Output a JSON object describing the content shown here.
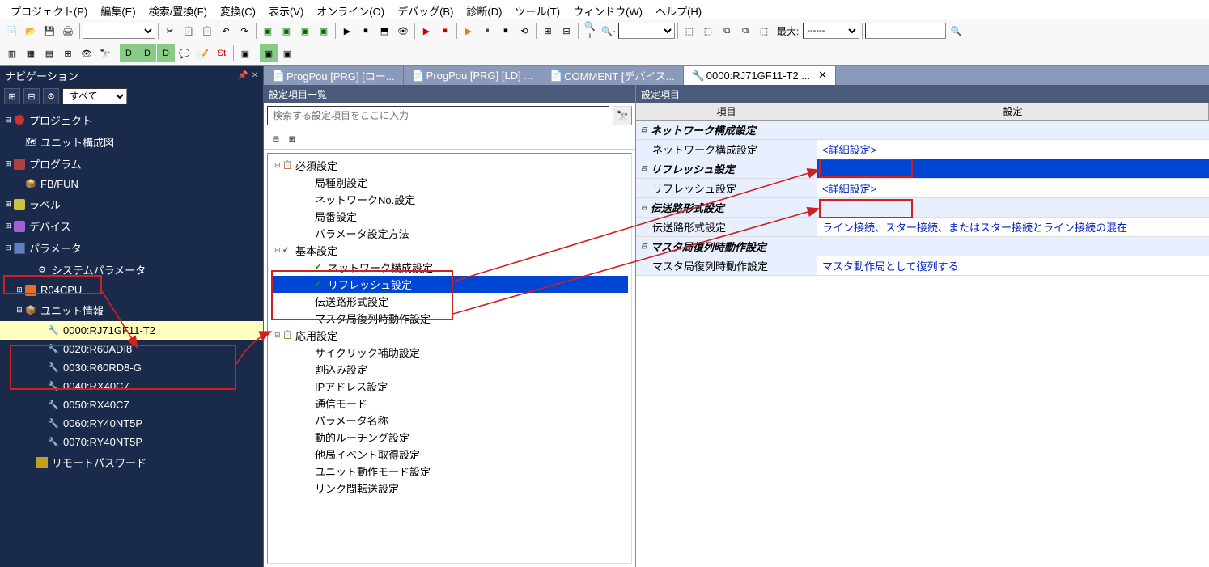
{
  "menu": {
    "project": "プロジェクト(P)",
    "edit": "編集(E)",
    "search": "検索/置換(F)",
    "convert": "変換(C)",
    "view": "表示(V)",
    "online": "オンライン(O)",
    "debug": "デバッグ(B)",
    "diag": "診断(D)",
    "tool": "ツール(T)",
    "window": "ウィンドウ(W)",
    "help": "ヘルプ(H)"
  },
  "toolbar": {
    "max_label": "最大:",
    "max_value": "------"
  },
  "nav": {
    "title": "ナビゲーション",
    "filter": "すべて",
    "tree": {
      "project": "プロジェクト",
      "unitmap": "ユニット構成図",
      "program": "プログラム",
      "fbfun": "FB/FUN",
      "label": "ラベル",
      "device": "デバイス",
      "param": "パラメータ",
      "sysparam": "システムパラメータ",
      "cpu": "R04CPU",
      "unitinfo": "ユニット情報",
      "u0000": "0000:RJ71GF11-T2",
      "u0020": "0020:R60ADI8",
      "u0030": "0030:R60RD8-G",
      "u0040": "0040:RX40C7",
      "u0050": "0050:RX40C7",
      "u0060": "0060:RY40NT5P",
      "u0070": "0070:RY40NT5P",
      "remotepw": "リモートパスワード"
    }
  },
  "tabs": {
    "t1": "ProgPou [PRG] [ロー...",
    "t2": "ProgPou [PRG] [LD] ...",
    "t3": "COMMENT [デバイス...",
    "t4": "0000:RJ71GF11-T2 ..."
  },
  "panels": {
    "list_title": "設定項目一覧",
    "detail_title": "設定項目",
    "search_placeholder": "検索する設定項目をここに入力"
  },
  "settings_tree": {
    "required": "必須設定",
    "station_type": "局種別設定",
    "network_no": "ネットワークNo.設定",
    "station_no": "局番設定",
    "param_method": "パラメータ設定方法",
    "basic": "基本設定",
    "net_config": "ネットワーク構成設定",
    "refresh": "リフレッシュ設定",
    "trans_format": "伝送路形式設定",
    "master_return": "マスタ局復列時動作設定",
    "applied": "応用設定",
    "cyclic": "サイクリック補助設定",
    "interrupt": "割込み設定",
    "ipaddr": "IPアドレス設定",
    "comm_mode": "通信モード",
    "param_name": "パラメータ名称",
    "dyn_routing": "動的ルーチング設定",
    "other_event": "他局イベント取得設定",
    "unit_mode": "ユニット動作モード設定",
    "link_xfer": "リンク間転送設定"
  },
  "detail_grid": {
    "col_item": "項目",
    "col_value": "設定",
    "rows": {
      "net_config_cat": "ネットワーク構成設定",
      "net_config": "ネットワーク構成設定",
      "net_config_val": "<詳細設定>",
      "refresh_cat": "リフレッシュ設定",
      "refresh": "リフレッシュ設定",
      "refresh_val": "<詳細設定>",
      "trans_cat": "伝送路形式設定",
      "trans": "伝送路形式設定",
      "trans_val": "ライン接続、スター接続、またはスター接続とライン接続の混在",
      "master_cat": "マスタ局復列時動作設定",
      "master": "マスタ局復列時動作設定",
      "master_val": "マスタ動作局として復列する"
    }
  }
}
